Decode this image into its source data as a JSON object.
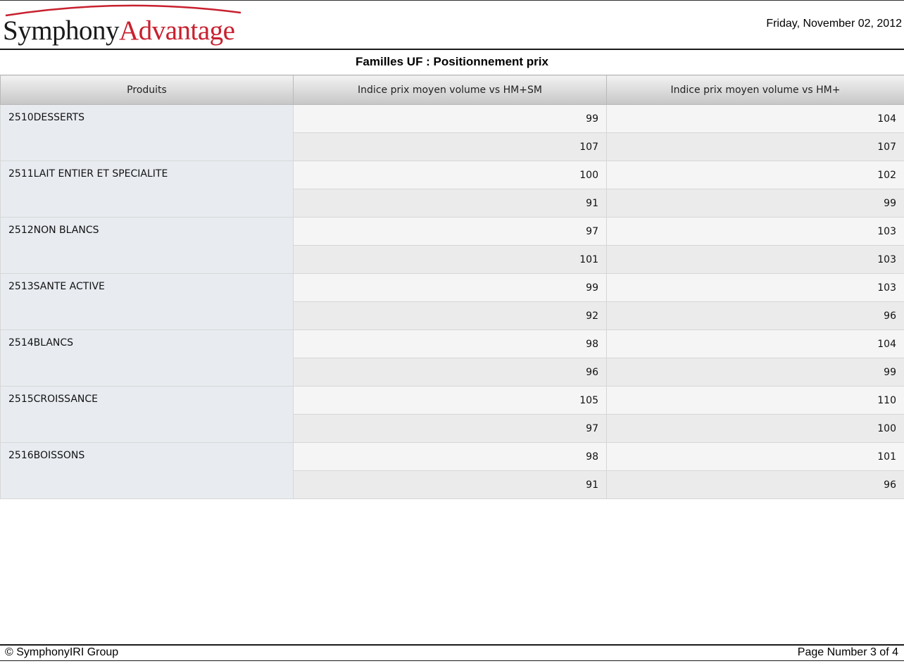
{
  "header": {
    "logo": {
      "part1": "Symphony",
      "part2": "Advantage",
      "arc_color": "#c8202e",
      "text_color": "#1a1a1a",
      "accent_color": "#c8202e"
    },
    "date": "Friday, November 02, 2012"
  },
  "report": {
    "title": "Familles UF : Positionnement prix"
  },
  "table": {
    "columns": [
      "Produits",
      "Indice prix moyen volume vs HM+SM",
      "Indice prix moyen volume vs HM+"
    ],
    "rows": [
      {
        "product": "2510DESSERTS",
        "values": [
          [
            "99",
            "104"
          ],
          [
            "107",
            "107"
          ]
        ]
      },
      {
        "product": "2511LAIT ENTIER ET SPECIALITE",
        "values": [
          [
            "100",
            "102"
          ],
          [
            "91",
            "99"
          ]
        ]
      },
      {
        "product": "2512NON BLANCS",
        "values": [
          [
            "97",
            "103"
          ],
          [
            "101",
            "103"
          ]
        ]
      },
      {
        "product": "2513SANTE ACTIVE",
        "values": [
          [
            "99",
            "103"
          ],
          [
            "92",
            "96"
          ]
        ]
      },
      {
        "product": "2514BLANCS",
        "values": [
          [
            "98",
            "104"
          ],
          [
            "96",
            "99"
          ]
        ]
      },
      {
        "product": "2515CROISSANCE",
        "values": [
          [
            "105",
            "110"
          ],
          [
            "97",
            "100"
          ]
        ]
      },
      {
        "product": "2516BOISSONS",
        "values": [
          [
            "98",
            "101"
          ],
          [
            "91",
            "96"
          ]
        ]
      }
    ]
  },
  "footer": {
    "copyright": "© SymphonyIRI Group",
    "page_number": "Page Number 3 of 4"
  }
}
